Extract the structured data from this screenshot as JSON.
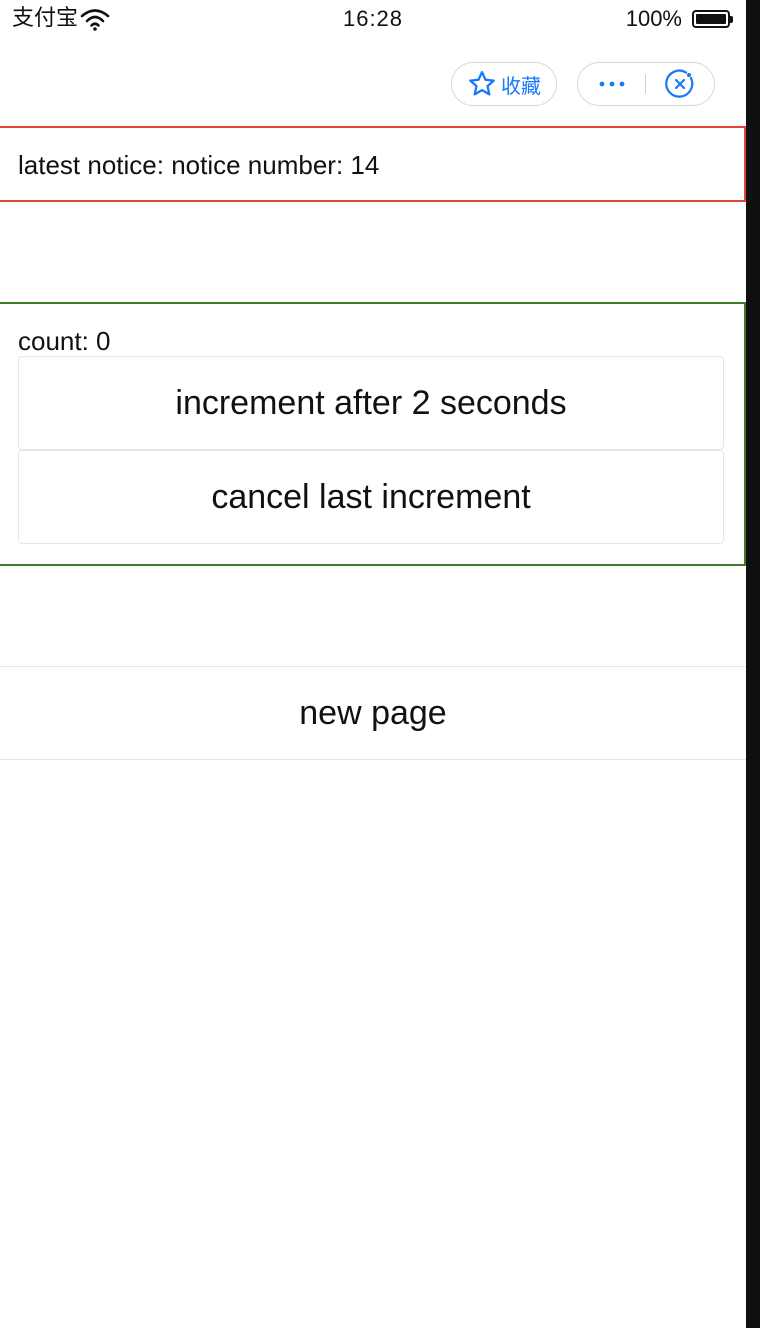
{
  "status_bar": {
    "carrier": "支付宝",
    "time": "16:28",
    "battery": "100%"
  },
  "nav": {
    "favorite_label": "收藏",
    "icons": [
      "star-icon",
      "more-icon",
      "close-icon"
    ]
  },
  "notice": {
    "text": "latest notice: notice number: 14"
  },
  "counter": {
    "count_text": "count: 0",
    "increment_label": "increment after 2 seconds",
    "cancel_label": "cancel last increment"
  },
  "footer": {
    "new_page_label": "new page"
  },
  "colors": {
    "notice_border": "#e0463a",
    "counter_border": "#3d7d28",
    "accent": "#1677ff"
  }
}
